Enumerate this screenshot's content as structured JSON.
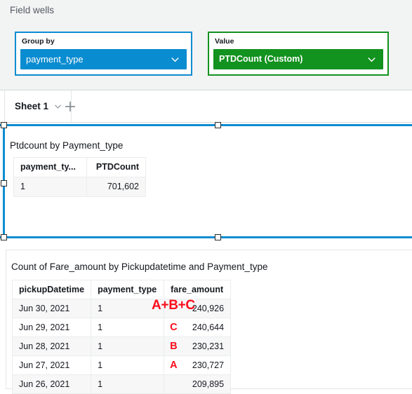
{
  "field_wells": {
    "title": "Field wells",
    "wells": [
      {
        "label": "Group by",
        "pill_text": "payment_type",
        "border_color": "#0a8cd0",
        "pill_color": "#0a8cd0",
        "chevron_icon": "chevron-down-icon"
      },
      {
        "label": "Value",
        "pill_text": "PTDCount (Custom)",
        "border_color": "#12921f",
        "pill_color": "#12921f",
        "chevron_icon": "chevron-down-icon"
      }
    ]
  },
  "tabbar": {
    "sheet_label": "Sheet 1",
    "sheet_menu_icon": "chevron-down-icon",
    "add_sheet_icon": "plus-icon"
  },
  "visuals": [
    {
      "title": "Ptdcount by Payment_type",
      "selected": true,
      "table": {
        "headers": [
          "payment_ty...",
          "PTDCount"
        ],
        "rows": [
          [
            "1",
            "701,602"
          ]
        ]
      },
      "annotation": "A+B+C"
    },
    {
      "title": "Count of Fare_amount by Pickupdatetime and Payment_type",
      "selected": false,
      "table": {
        "headers": [
          "pickupDatetime",
          "payment_type",
          "fare_amount"
        ],
        "rows": [
          {
            "pickupDatetime": "Jun 30, 2021",
            "payment_type": "1",
            "fare_amount": "240,926",
            "letter": ""
          },
          {
            "pickupDatetime": "Jun 29, 2021",
            "payment_type": "1",
            "fare_amount": "240,644",
            "letter": "C"
          },
          {
            "pickupDatetime": "Jun 28, 2021",
            "payment_type": "1",
            "fare_amount": "230,231",
            "letter": "B"
          },
          {
            "pickupDatetime": "Jun 27, 2021",
            "payment_type": "1",
            "fare_amount": "230,727",
            "letter": "A"
          },
          {
            "pickupDatetime": "Jun 26, 2021",
            "payment_type": "1",
            "fare_amount": "209,895",
            "letter": ""
          }
        ]
      }
    }
  ],
  "colors": {
    "annotation_red": "#fc0d1b",
    "selection_blue": "#0a8cd0",
    "group_by_blue": "#0a8cd0",
    "value_green": "#12921f",
    "panel_gray": "#f2f3f3"
  }
}
